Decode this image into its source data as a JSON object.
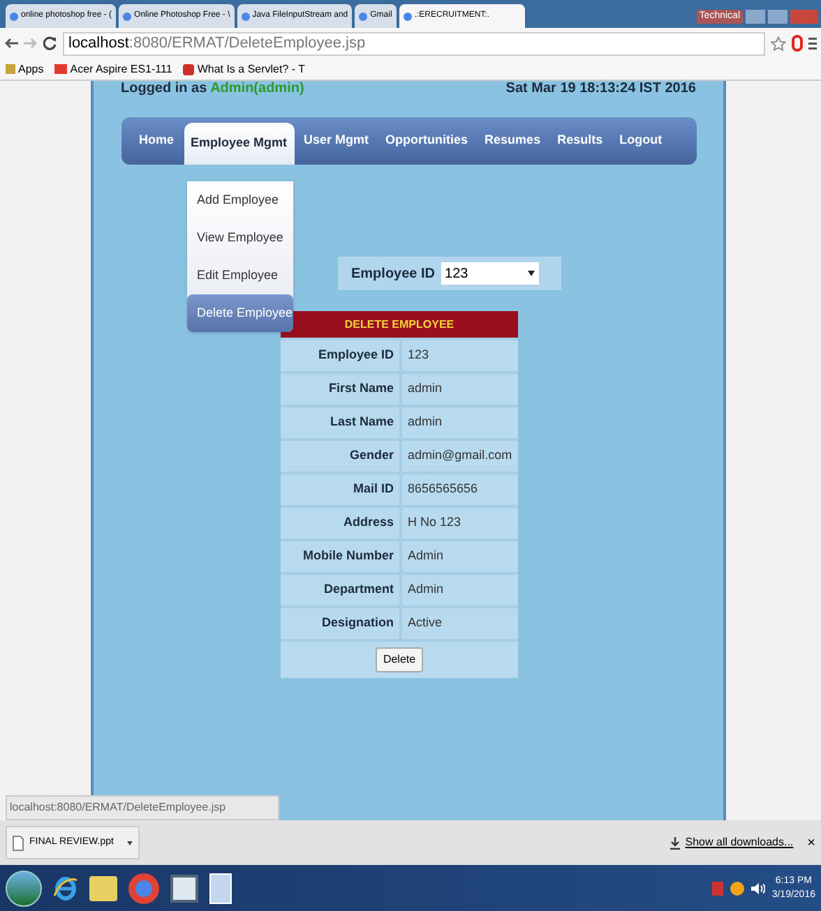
{
  "browser_tabs": [
    {
      "label": "online photoshop free - (",
      "selected": false
    },
    {
      "label": "Online Photoshop Free - \\",
      "selected": false
    },
    {
      "label": "Java FileInputStream and",
      "selected": false
    },
    {
      "label": "Gmail",
      "selected": false
    },
    {
      "label": ".:ERECRUITMENT:.",
      "selected": true
    }
  ],
  "window_buttons": {
    "user": "Technical"
  },
  "address_bar": {
    "host": "localhost",
    "path": ":8080/ERMAT/DeleteEmployee.jsp"
  },
  "bookmarks": [
    {
      "label": "Apps",
      "kind": "apps"
    },
    {
      "label": "Acer Aspire ES1-111",
      "kind": "sd"
    },
    {
      "label": "What Is a Servlet? - T",
      "kind": "page"
    }
  ],
  "header": {
    "logged_prefix": "Logged in as",
    "user": "Admin(admin)",
    "datetime": "Sat Mar 19 18:13:24 IST 2016"
  },
  "nav": [
    {
      "label": "Home",
      "selected": false
    },
    {
      "label": "Employee Mgmt",
      "selected": true
    },
    {
      "label": "User Mgmt",
      "selected": false
    },
    {
      "label": "Opportunities",
      "selected": false
    },
    {
      "label": "Resumes",
      "selected": false
    },
    {
      "label": "Results",
      "selected": false
    },
    {
      "label": "Logout",
      "selected": false
    }
  ],
  "dropdown_menu": [
    {
      "label": "Add Employee",
      "selected": false
    },
    {
      "label": "View Employee",
      "selected": false
    },
    {
      "label": "Edit Employee",
      "selected": false
    },
    {
      "label": "Delete Employee",
      "selected": true
    }
  ],
  "employee_select": {
    "label": "Employee ID",
    "value": "123"
  },
  "table": {
    "title": "DELETE EMPLOYEE",
    "rows": [
      {
        "label": "Employee ID",
        "value": "123"
      },
      {
        "label": "First Name",
        "value": "admin"
      },
      {
        "label": "Last Name",
        "value": "admin"
      },
      {
        "label": "Gender",
        "value": "admin@gmail.com"
      },
      {
        "label": "Mail ID",
        "value": "8656565656"
      },
      {
        "label": "Address",
        "value": "H No 123"
      },
      {
        "label": "Mobile Number",
        "value": "Admin"
      },
      {
        "label": "Department",
        "value": "Admin"
      },
      {
        "label": "Designation",
        "value": "Active"
      }
    ],
    "button": "Delete"
  },
  "status_url": "localhost:8080/ERMAT/DeleteEmployee.jsp",
  "downloads": {
    "file": "FINAL REVIEW.ppt",
    "show_all": "Show all downloads...",
    "close": "×"
  },
  "taskbar": {
    "time": "6:13 PM",
    "date": "3/19/2016"
  }
}
